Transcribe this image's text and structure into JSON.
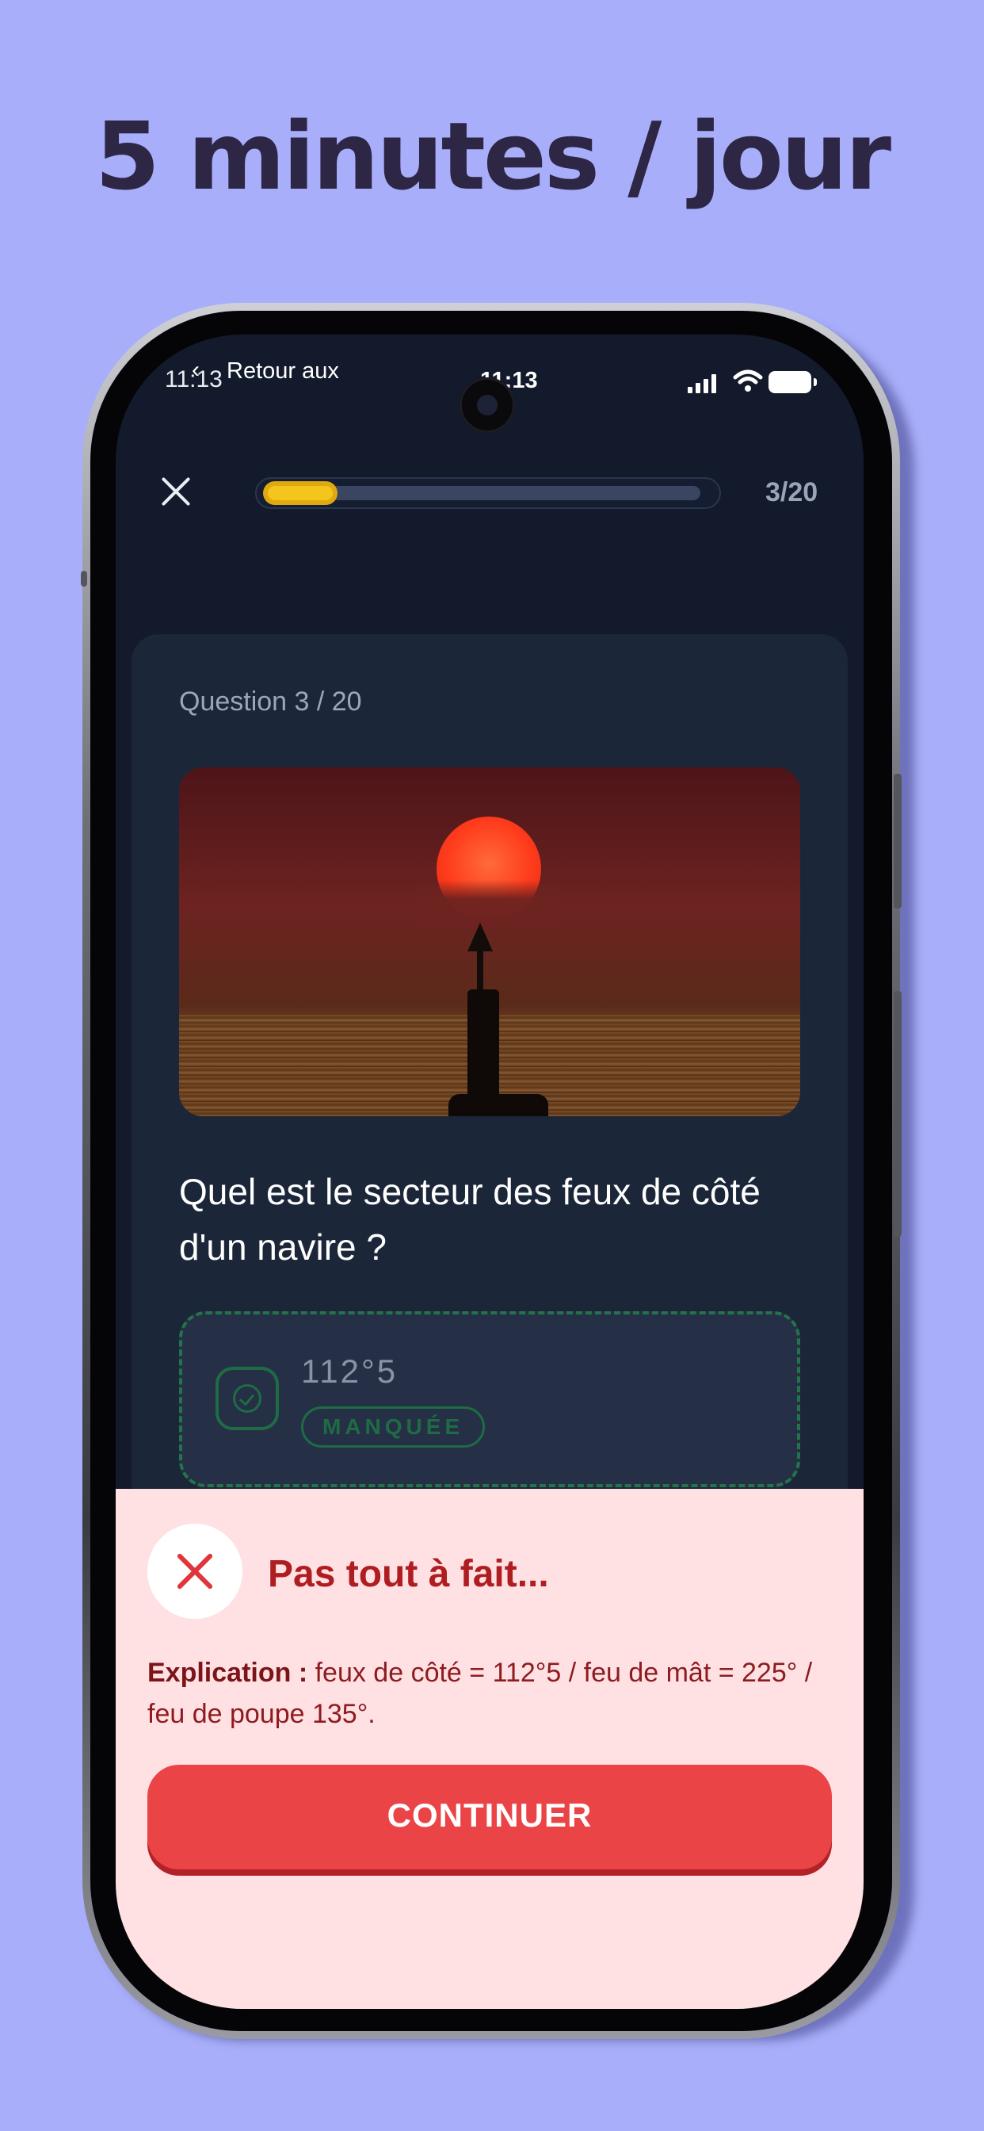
{
  "headline": "5 minutes / jour",
  "status_bar": {
    "time_left": "11:13",
    "back_label": "Retour aux",
    "time_center": "11:13"
  },
  "quiz": {
    "progress_count": "3/20",
    "progress_fraction": 0.15,
    "question_label": "Question 3 / 20",
    "question_text": "Quel est le secteur des feux de côté d'un navire ?",
    "answer": {
      "value": "112°5",
      "badge": "MANQUÉE"
    }
  },
  "feedback": {
    "title": "Pas tout à fait...",
    "explanation_label": "Explication :",
    "explanation_text": " feux de côté = 112°5 / feu de mât = 225° / feu de poupe 135°.",
    "continue_label": "CONTINUER"
  },
  "colors": {
    "background": "#a8aef9",
    "screen": "#121a2b",
    "progress": "#f4c51d",
    "answer_correct": "#22744a",
    "error": "#ea4447",
    "feedback_bg": "#ffe1e3"
  }
}
